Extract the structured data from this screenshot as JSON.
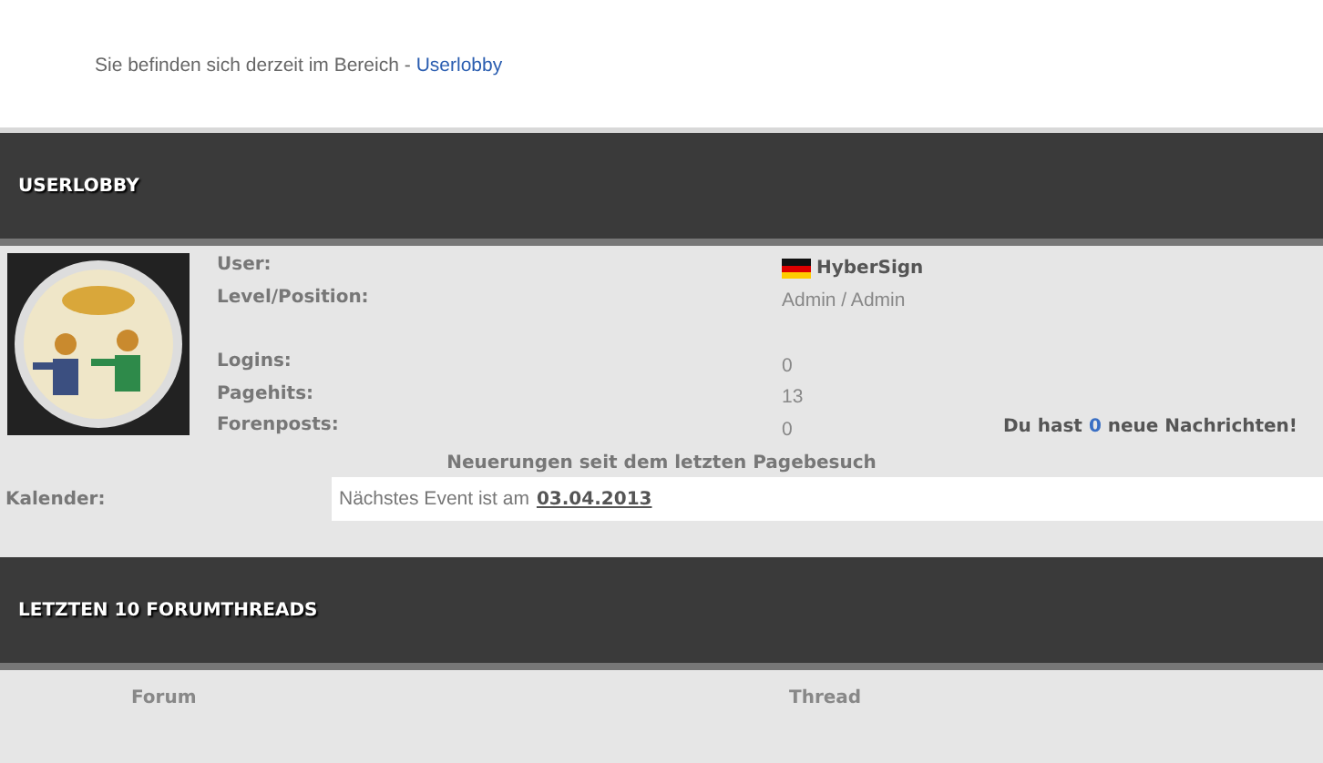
{
  "breadcrumb": {
    "text": "Sie befinden sich derzeit im Bereich -",
    "link": "Userlobby"
  },
  "userlobby": {
    "title": "USERLOBBY",
    "identity": [
      {
        "label": "User:",
        "value": "HyberSign",
        "kind": "user"
      },
      {
        "label": "Level/Position:",
        "value": "Admin / Admin",
        "kind": "plain"
      }
    ],
    "stats": [
      {
        "label": "Logins:",
        "value": "0"
      },
      {
        "label": "Pagehits:",
        "value": "13"
      },
      {
        "label": "Forenposts:",
        "value": "0"
      }
    ],
    "messages": {
      "prefix": "Du hast",
      "count": "0",
      "suffix": "neue Nachrichten!"
    },
    "news_heading": "Neuerungen seit dem letzten Pagebesuch",
    "calendar": {
      "label": "Kalender:",
      "text": "Nächstes Event ist am",
      "date": "03.04.2013"
    }
  },
  "forumthreads": {
    "title": "LETZTEN 10 FORUMTHREADS",
    "columns": [
      "Forum",
      "Thread"
    ]
  }
}
